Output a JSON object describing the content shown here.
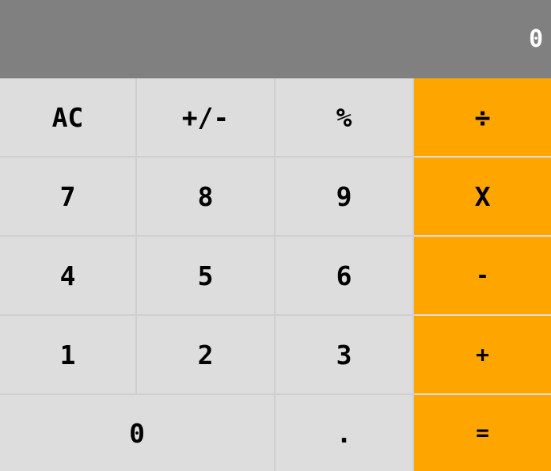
{
  "display": {
    "value": "0"
  },
  "keys": {
    "clear": "AC",
    "sign": "+/-",
    "percent": "%",
    "divide": "÷",
    "seven": "7",
    "eight": "8",
    "nine": "9",
    "multiply": "X",
    "four": "4",
    "five": "5",
    "six": "6",
    "minus": "-",
    "one": "1",
    "two": "2",
    "three": "3",
    "plus": "+",
    "zero": "0",
    "decimal": ".",
    "equals": "="
  },
  "colors": {
    "display_background": "#808080",
    "number_key_background": "#dddddd",
    "operator_key_background": "#ffa500",
    "text": "#000000",
    "display_text": "#ffffff"
  }
}
